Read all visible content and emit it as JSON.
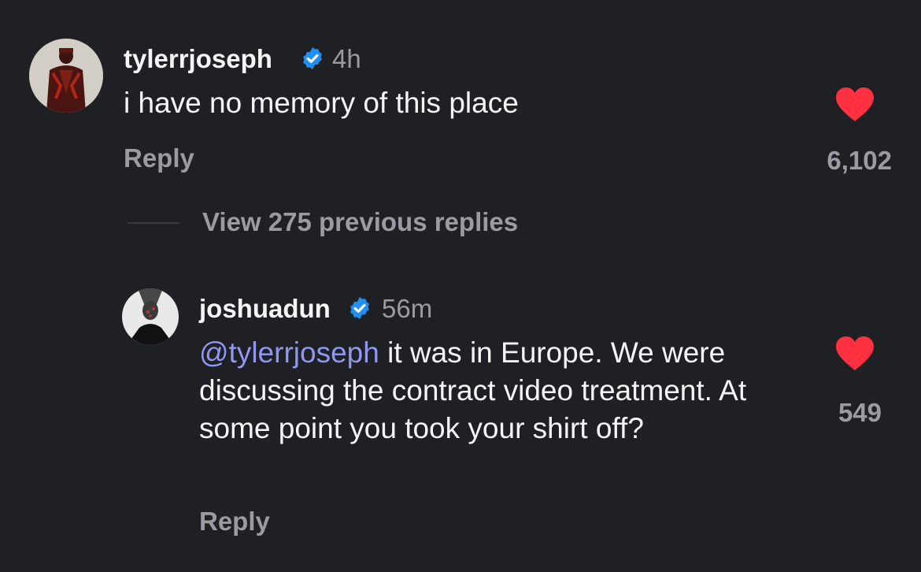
{
  "comment": {
    "username": "tylerrjoseph",
    "timestamp": "4h",
    "text": "i have no memory of this place",
    "reply_label": "Reply",
    "like_count": "6,102",
    "liked": true
  },
  "thread": {
    "view_replies_label": "View 275 previous replies"
  },
  "reply": {
    "username": "joshuadun",
    "timestamp": "56m",
    "mention": "@tylerrjoseph",
    "text": " it was in Europe. We were discussing the contract video treatment. At some point you took your shirt off?",
    "reply_label": "Reply",
    "like_count": "549",
    "liked": true
  },
  "colors": {
    "background": "#1f2024",
    "heart": "#ff3040",
    "verified": "#1f8ff0",
    "mention": "#8f97f0",
    "secondary_text": "#9a9ca3"
  },
  "icons": {
    "verified": "verified-badge-icon",
    "like": "heart-icon"
  }
}
